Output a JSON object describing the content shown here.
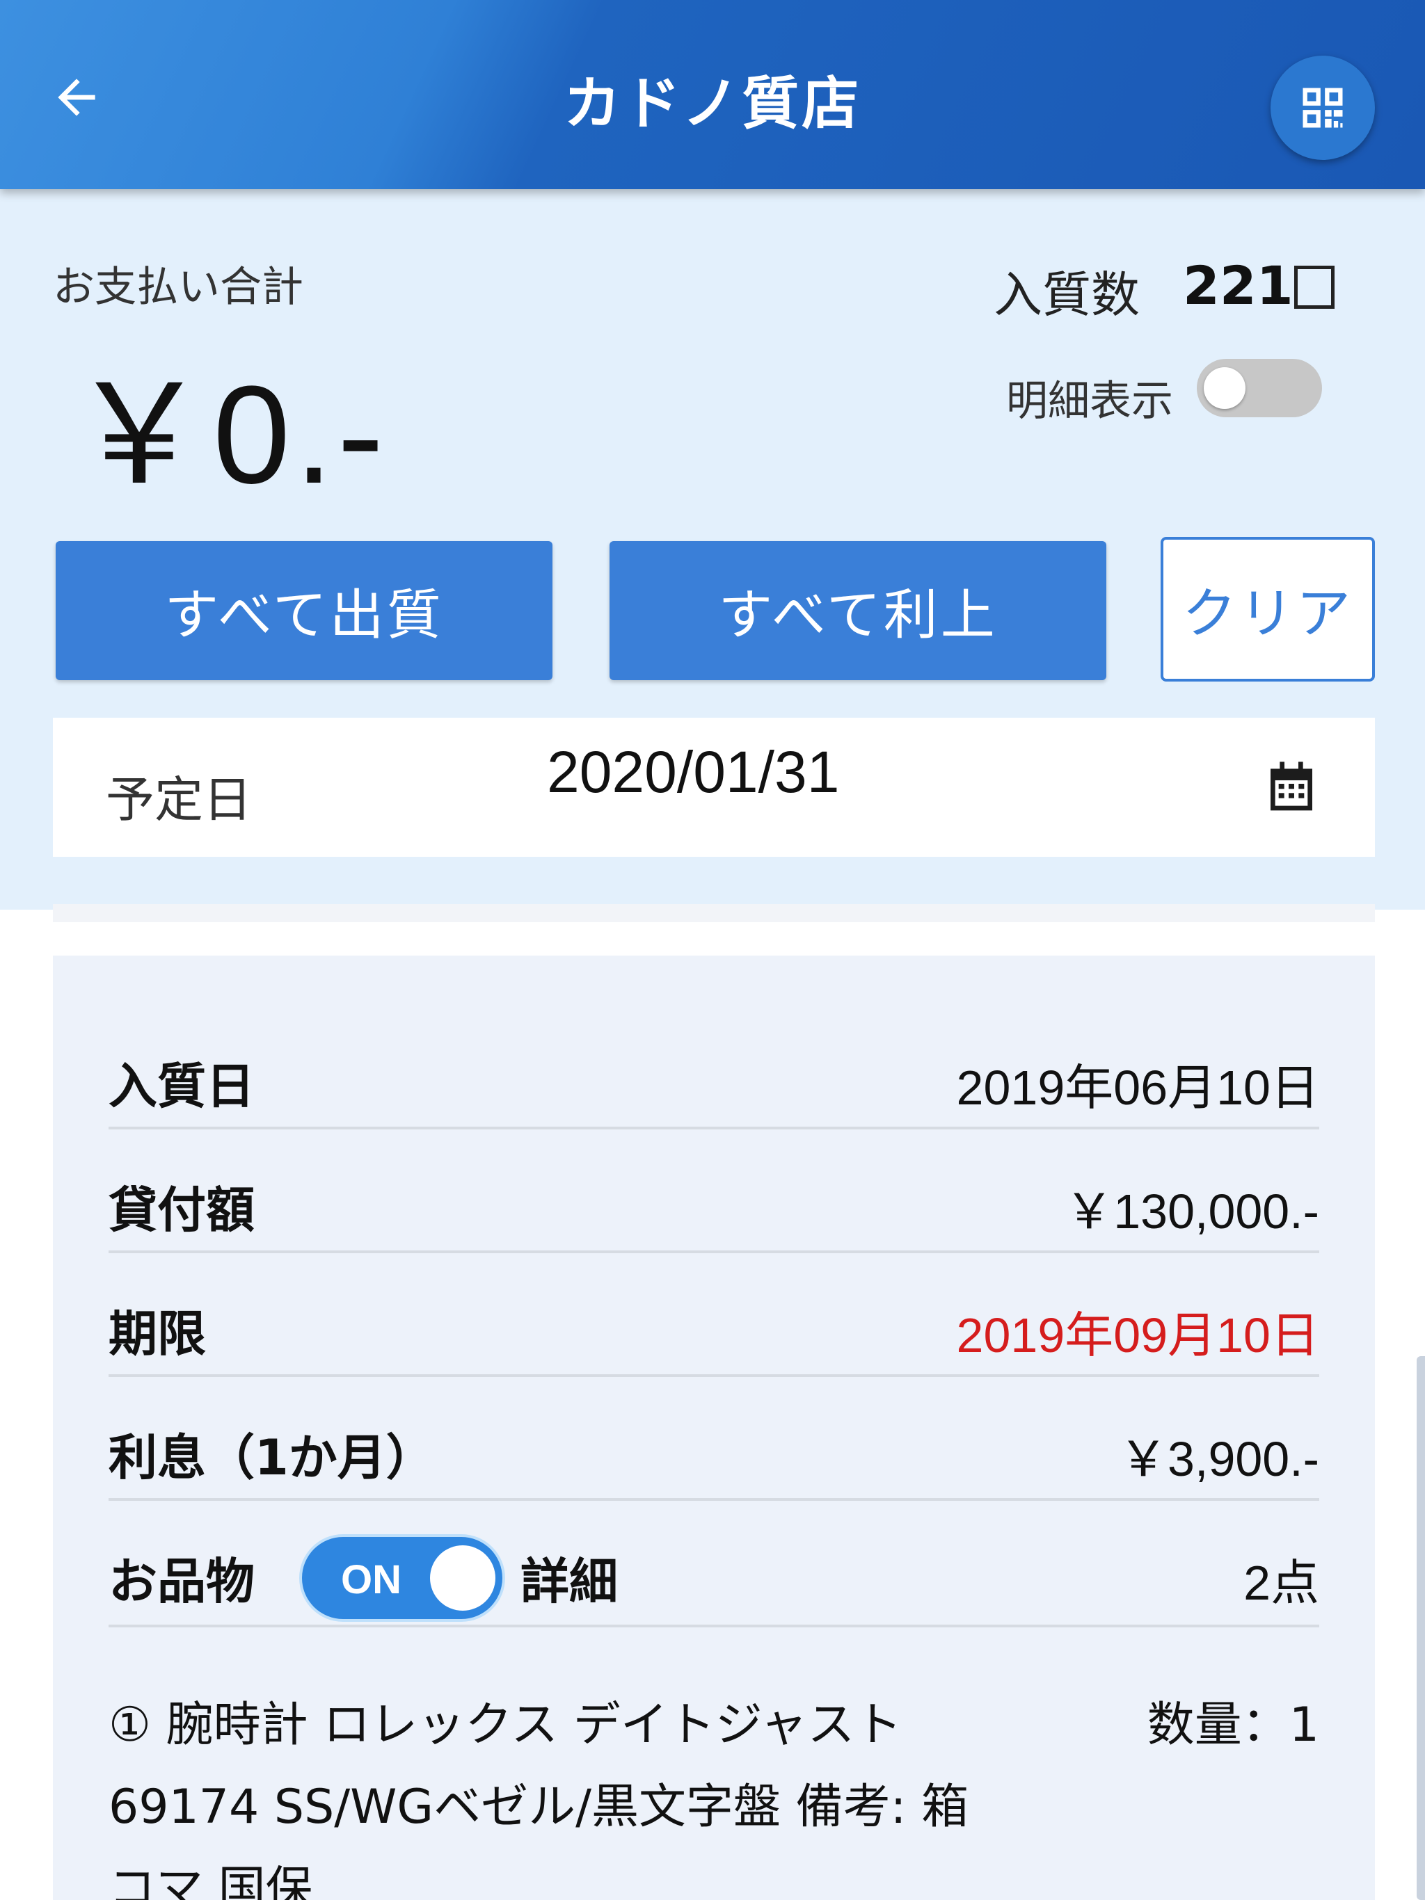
{
  "appbar": {
    "title": "カドノ質店",
    "back_icon": "arrow-left-icon",
    "qr_icon": "qr-code-icon"
  },
  "summary": {
    "pay_label": "お支払い合計",
    "pay_amount": "￥0.-",
    "count_label": "入質数",
    "count_value": "221",
    "detail_label": "明細表示",
    "detail_toggle_on": false
  },
  "actions": {
    "redeem_all": "すべて出質",
    "interest_all": "すべて利上",
    "clear": "クリア"
  },
  "schedule": {
    "label": "予定日",
    "date": "2020/01/31",
    "calendar_icon": "calendar-icon"
  },
  "item": {
    "rows": [
      {
        "key": "入質日",
        "value": "2019年06月10日"
      },
      {
        "key": "貸付額",
        "value": "￥130,000.-"
      },
      {
        "key": "期限",
        "value": "2019年09月10日"
      },
      {
        "key": "利息（1か月）",
        "value": "￥3,900.-"
      }
    ],
    "goods": {
      "key": "お品物",
      "toggle_text": "ON",
      "detail_label": "詳細",
      "count": "2点"
    },
    "desc_line1": "① 腕時計 ロレックス デイトジャスト",
    "desc_line2": "69174 SS/WGベゼル/黒文字盤 備考: 箱",
    "desc_line3": "コマ 国保",
    "qty": "数量：1"
  },
  "colors": {
    "primary": "#3a7fd8",
    "panel": "#e3f0fc",
    "alert": "#d51d1d"
  }
}
